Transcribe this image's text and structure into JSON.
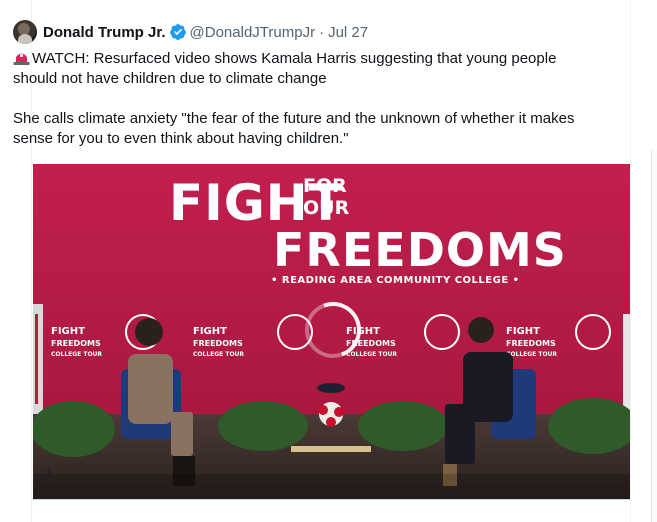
{
  "tweet": {
    "author": {
      "display_name": "Donald Trump Jr.",
      "handle": "@DonaldJTrumpJr",
      "separator": "·",
      "date": "Jul 27"
    },
    "text_line1": "WATCH: Resurfaced video shows Kamala Harris suggesting that young people should not have children due to climate change",
    "text_line2": "She calls climate anxiety \"the fear of the future and the unknown of whether it makes sense for you to even think about having children.\"",
    "emoji_icon": "police-light-icon"
  },
  "video": {
    "backdrop": {
      "headline_1": "FIGHT",
      "headline_for": "FOR",
      "headline_our": "OUR",
      "headline_2": "FREEDOMS",
      "subtitle": "• READING AREA COMMUNITY COLLEGE •",
      "small_logo_line1": "FIGHT",
      "small_logo_line2": "FREEDOMS",
      "small_logo_line3": "COLLEGE TOUR"
    },
    "state": "loading",
    "colors": {
      "backdrop": "#b51e4a",
      "stage_floor": "#3a2a2a",
      "chair_blue": "#1f3a7a"
    }
  },
  "colors": {
    "text_primary": "#0f1419",
    "text_secondary": "#536471",
    "verified_blue": "#1d9bf0"
  }
}
